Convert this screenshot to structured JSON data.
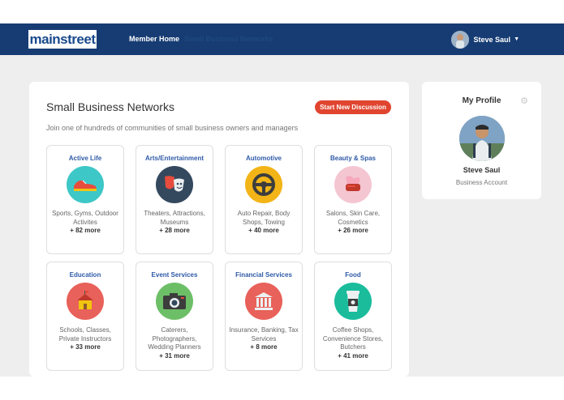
{
  "header": {
    "logo": "mainstreet",
    "nav_member_home": "Member Home",
    "nav_second": "Small Business Networks",
    "user_name": "Steve Saul"
  },
  "main": {
    "title": "Small Business Networks",
    "subtitle": "Join one of hundreds of communities of small business owners and managers",
    "start_button": "Start New Discussion",
    "cards": [
      {
        "title": "Active Life",
        "desc": "Sports, Gyms, Outdoor Activites",
        "more": "+ 82 more",
        "icon": "sneaker-icon",
        "color": "#3ec7c7"
      },
      {
        "title": "Arts/Entertainment",
        "desc": "Theaters, Attractions, Museums",
        "more": "+ 28 more",
        "icon": "theater-masks-icon",
        "color": "#34495e"
      },
      {
        "title": "Automotive",
        "desc": "Auto Repair, Body Shops, Towing",
        "more": "+ 40 more",
        "icon": "steering-wheel-icon",
        "color": "#f2b416"
      },
      {
        "title": "Beauty & Spas",
        "desc": "Salons, Skin Care, Cosmetics",
        "more": "+ 26 more",
        "icon": "lipstick-icon",
        "color": "#f4c6d2"
      },
      {
        "title": "Education",
        "desc": "Schools, Classes, Private Instructors",
        "more": "+ 33 more",
        "icon": "schoolhouse-icon",
        "color": "#e8615a"
      },
      {
        "title": "Event Services",
        "desc": "Caterers, Photographers, Wedding Planners",
        "more": "+ 31 more",
        "icon": "camera-icon",
        "color": "#6dbf67"
      },
      {
        "title": "Financial Services",
        "desc": "Insurance, Banking, Tax Services",
        "more": "+ 8 more",
        "icon": "bank-icon",
        "color": "#e8615a"
      },
      {
        "title": "Food",
        "desc": "Coffee Shops, Convenience Stores, Butchers",
        "more": "+ 41 more",
        "icon": "coffee-cup-icon",
        "color": "#1abc9c"
      }
    ]
  },
  "profile": {
    "title": "My Profile",
    "name": "Steve Saul",
    "account_type": "Business Account"
  },
  "colors": {
    "navbar": "#163c73",
    "accent": "#e0452f",
    "link": "#2f5aa7"
  }
}
